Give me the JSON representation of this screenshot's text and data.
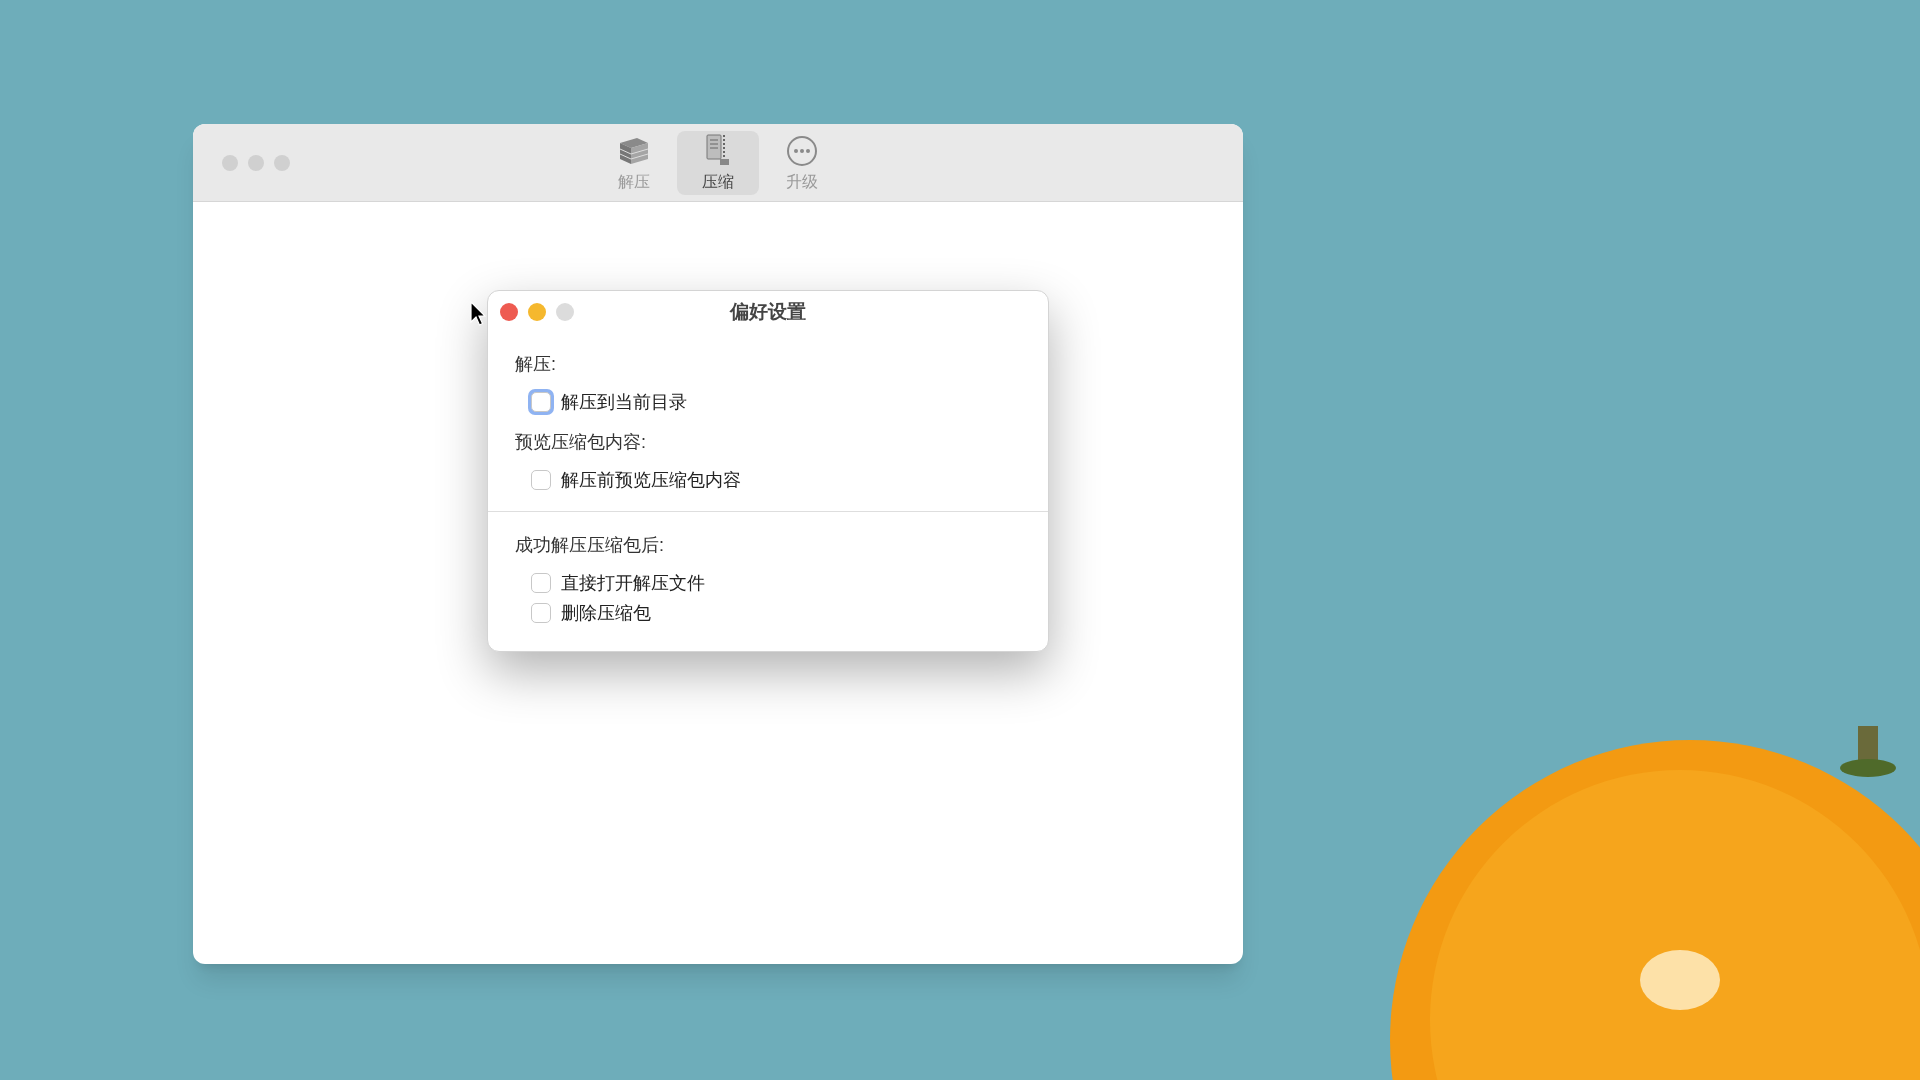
{
  "main_window": {
    "toolbar": [
      {
        "label": "解压",
        "kind": "extract",
        "selected": false
      },
      {
        "label": "压缩",
        "kind": "compress",
        "selected": true
      },
      {
        "label": "升级",
        "kind": "upgrade",
        "selected": false
      }
    ]
  },
  "preferences_dialog": {
    "title": "偏好设置",
    "sections": [
      {
        "groups": [
          {
            "label": "解压:",
            "options": [
              {
                "label": "解压到当前目录",
                "checked": false,
                "focused": true
              }
            ]
          },
          {
            "label": "预览压缩包内容:",
            "options": [
              {
                "label": "解压前预览压缩包内容",
                "checked": false,
                "focused": false
              }
            ]
          }
        ]
      },
      {
        "groups": [
          {
            "label": "成功解压压缩包后:",
            "options": [
              {
                "label": "直接打开解压文件",
                "checked": false,
                "focused": false
              },
              {
                "label": "删除压缩包",
                "checked": false,
                "focused": false
              }
            ]
          }
        ]
      }
    ]
  }
}
